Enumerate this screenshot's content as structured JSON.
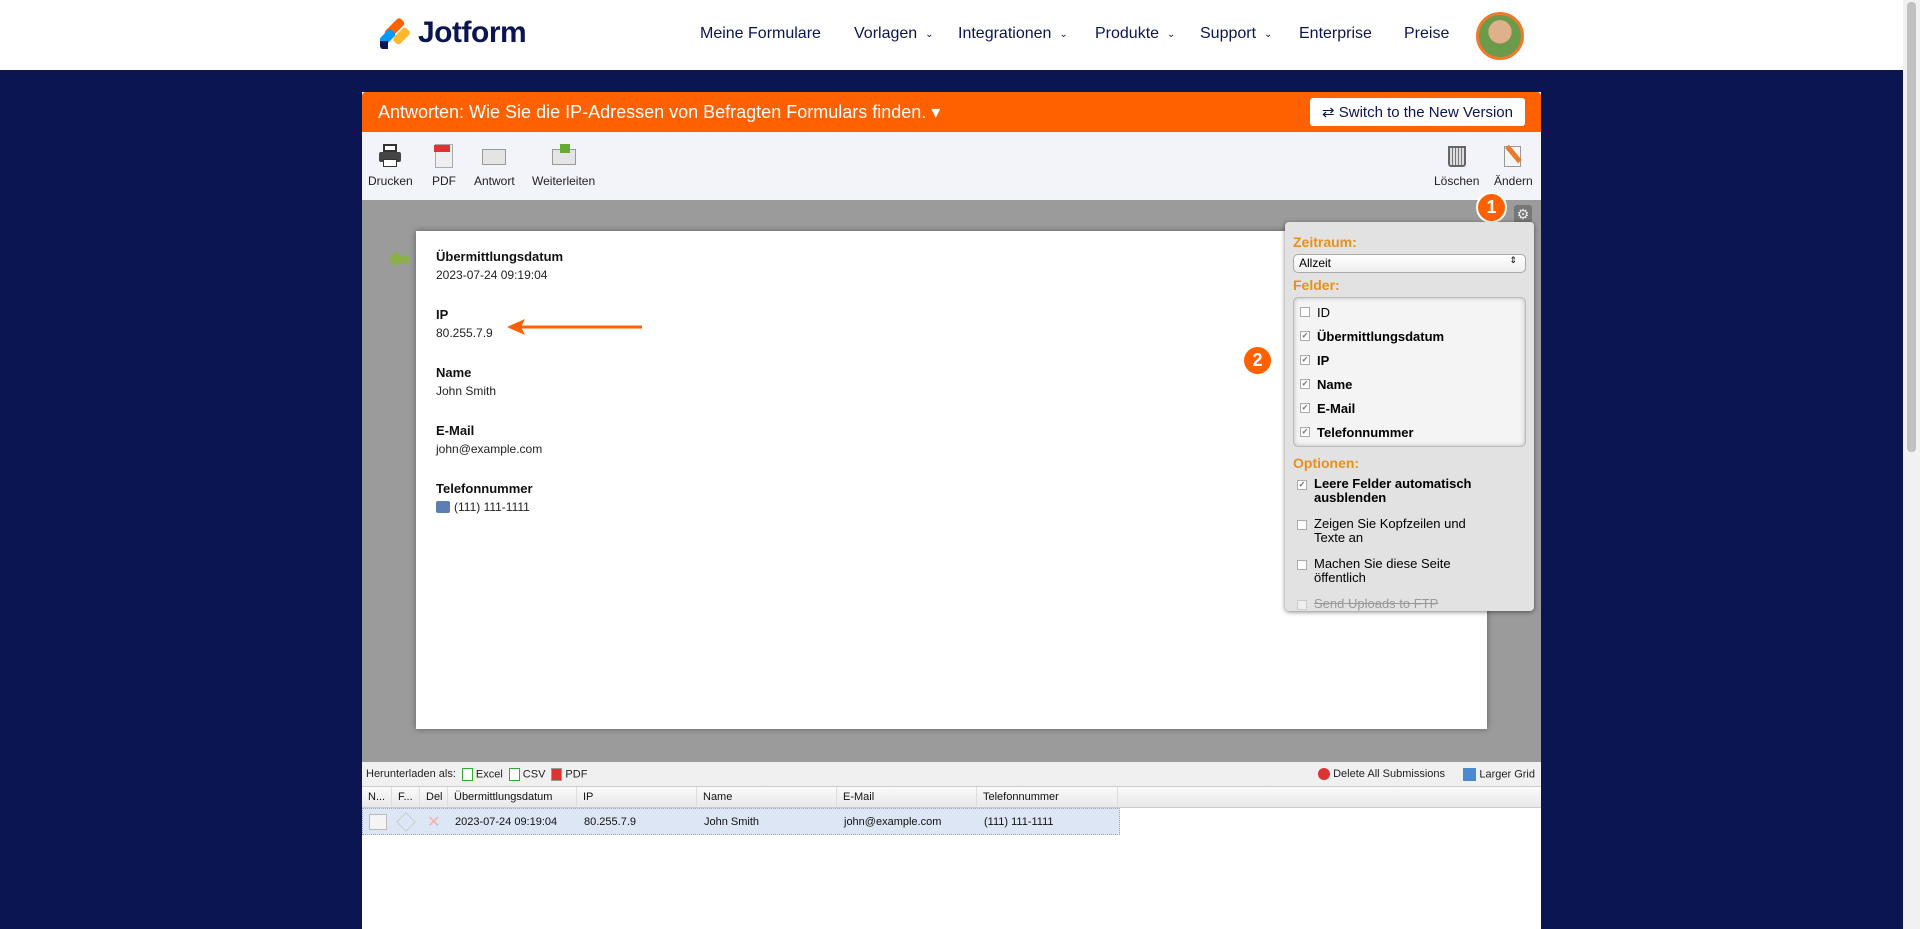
{
  "header": {
    "brand": "Jotform",
    "nav": [
      {
        "label": "Meine Formulare",
        "chevron": false
      },
      {
        "label": "Vorlagen",
        "chevron": true
      },
      {
        "label": "Integrationen",
        "chevron": true
      },
      {
        "label": "Produkte",
        "chevron": true
      },
      {
        "label": "Support",
        "chevron": true
      },
      {
        "label": "Enterprise",
        "chevron": false
      },
      {
        "label": "Preise",
        "chevron": false
      }
    ]
  },
  "titlebar": {
    "title": "Antworten: Wie Sie die IP-Adressen von Befragten Formulars finden. ▾",
    "switch_label": "⇄  Switch to the New Version"
  },
  "toolbar": {
    "left": [
      "Drucken",
      "PDF",
      "Antwort",
      "Weiterleiten"
    ],
    "right": [
      "Löschen",
      "Ändern"
    ]
  },
  "submission": {
    "fields": [
      {
        "label": "Übermittlungsdatum",
        "value": "2023-07-24 09:19:04"
      },
      {
        "label": "IP",
        "value": "80.255.7.9"
      },
      {
        "label": "Name",
        "value": "John Smith"
      },
      {
        "label": "E-Mail",
        "value": "john@example.com"
      },
      {
        "label": "Telefonnummer",
        "value": "(111) 111-1111"
      }
    ]
  },
  "settings": {
    "zeitraum_label": "Zeitraum:",
    "zeitraum_value": "Allzeit",
    "felder_label": "Felder:",
    "felder": [
      {
        "label": "ID",
        "checked": false
      },
      {
        "label": "Übermittlungsdatum",
        "checked": true
      },
      {
        "label": "IP",
        "checked": true
      },
      {
        "label": "Name",
        "checked": true
      },
      {
        "label": "E-Mail",
        "checked": true
      },
      {
        "label": "Telefonnummer",
        "checked": true
      }
    ],
    "optionen_label": "Optionen:",
    "optionen": [
      {
        "label": "Leere Felder automatisch ausblenden",
        "checked": true
      },
      {
        "label": "Zeigen Sie Kopfzeilen und Texte an",
        "checked": false
      },
      {
        "label": "Machen Sie diese Seite öffentlich",
        "checked": false
      },
      {
        "label": "Send Uploads to FTP",
        "checked": false,
        "disabled": true
      }
    ]
  },
  "badges": [
    "1",
    "2"
  ],
  "download": {
    "label": "Herunterladen als:",
    "excel": "Excel",
    "csv": "CSV",
    "pdf": "PDF",
    "delete_all": "Delete All Submissions",
    "larger": "Larger Grid"
  },
  "grid": {
    "columns": [
      "N...",
      "F...",
      "Del",
      "Übermittlungsdatum",
      "IP",
      "Name",
      "E-Mail",
      "Telefonnummer"
    ],
    "rows": [
      {
        "date": "2023-07-24 09:19:04",
        "ip": "80.255.7.9",
        "name": "John Smith",
        "email": "john@example.com",
        "phone": "(111) 111-1111"
      }
    ]
  },
  "colors": {
    "orange": "#ff6100",
    "navy": "#0b1551"
  }
}
